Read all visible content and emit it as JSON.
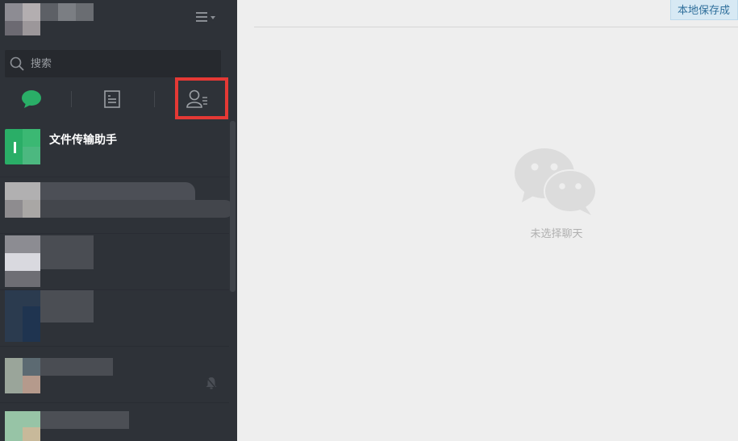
{
  "header": {
    "menu_icon": "hamburger-menu-icon"
  },
  "search": {
    "placeholder": "搜索",
    "icon": "search-icon"
  },
  "tabs": [
    {
      "name": "chat",
      "icon": "chat-bubble-icon",
      "active": true,
      "color": "#2aae67"
    },
    {
      "name": "articles",
      "icon": "document-icon",
      "active": false
    },
    {
      "name": "contacts",
      "icon": "contacts-icon",
      "active": false,
      "highlighted": true
    }
  ],
  "chats": [
    {
      "title": "文件传输助手"
    },
    {
      "title": ""
    },
    {
      "title": ""
    },
    {
      "title": ""
    },
    {
      "title": ""
    },
    {
      "title": ""
    }
  ],
  "main": {
    "toast": "本地保存成",
    "empty_text": "未选择聊天",
    "empty_icon": "wechat-logo-icon"
  },
  "colors": {
    "sidebar_bg": "#2e3238",
    "accent_green": "#2aae67",
    "highlight_red": "#e53935",
    "main_bg": "#eeeeee"
  }
}
